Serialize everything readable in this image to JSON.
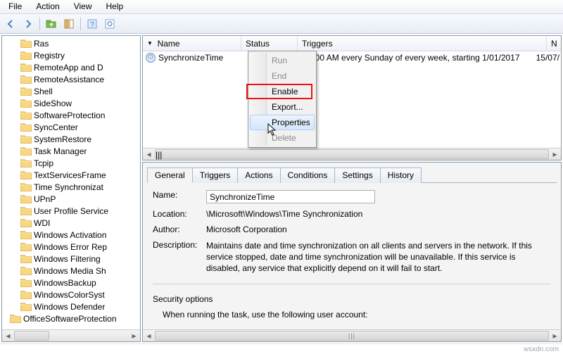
{
  "menubar": {
    "items": [
      "File",
      "Action",
      "View",
      "Help"
    ]
  },
  "tree": {
    "items": [
      {
        "l": 1,
        "t": "Ras"
      },
      {
        "l": 1,
        "t": "Registry"
      },
      {
        "l": 1,
        "t": "RemoteApp and D"
      },
      {
        "l": 1,
        "t": "RemoteAssistance"
      },
      {
        "l": 1,
        "t": "Shell"
      },
      {
        "l": 1,
        "t": "SideShow"
      },
      {
        "l": 1,
        "t": "SoftwareProtection"
      },
      {
        "l": 1,
        "t": "SyncCenter"
      },
      {
        "l": 1,
        "t": "SystemRestore"
      },
      {
        "l": 1,
        "t": "Task Manager"
      },
      {
        "l": 1,
        "t": "Tcpip"
      },
      {
        "l": 1,
        "t": "TextServicesFrame"
      },
      {
        "l": 1,
        "t": "Time Synchronizat"
      },
      {
        "l": 1,
        "t": "UPnP"
      },
      {
        "l": 1,
        "t": "User Profile Service"
      },
      {
        "l": 1,
        "t": "WDI"
      },
      {
        "l": 1,
        "t": "Windows Activation"
      },
      {
        "l": 1,
        "t": "Windows Error Rep"
      },
      {
        "l": 1,
        "t": "Windows Filtering"
      },
      {
        "l": 1,
        "t": "Windows Media Sh"
      },
      {
        "l": 1,
        "t": "WindowsBackup"
      },
      {
        "l": 1,
        "t": "WindowsColorSyst"
      },
      {
        "l": 1,
        "t": "Windows Defender"
      },
      {
        "l": 0,
        "t": "OfficeSoftwareProtection"
      }
    ]
  },
  "columns": {
    "name": "Name",
    "status": "Status",
    "triggers": "Triggers",
    "n": "N"
  },
  "col_sort_glyph": "▼",
  "task_row": {
    "state_glyph": "⊙",
    "name": "SynchronizeTime",
    "trigger_text": "At 1:00 AM every Sunday of every week, starting 1/01/2017",
    "next_run": "15/07/"
  },
  "context_menu": {
    "items": [
      {
        "k": "run",
        "label": "Run",
        "disabled": true
      },
      {
        "k": "end",
        "label": "End",
        "disabled": true
      },
      {
        "k": "enable",
        "label": "Enable",
        "disabled": false,
        "mark": true
      },
      {
        "k": "export",
        "label": "Export...",
        "disabled": false
      },
      {
        "k": "properties",
        "label": "Properties",
        "disabled": false,
        "hover": true
      },
      {
        "k": "delete",
        "label": "Delete",
        "disabled": true
      }
    ]
  },
  "tabs": {
    "items": [
      "General",
      "Triggers",
      "Actions",
      "Conditions",
      "Settings",
      "History"
    ],
    "active": "General"
  },
  "general": {
    "labels": {
      "name": "Name:",
      "location": "Location:",
      "author": "Author:",
      "description": "Description:",
      "security_options": "Security options",
      "running_user": "When running the task, use the following user account:"
    },
    "values": {
      "name": "SynchronizeTime",
      "location": "\\Microsoft\\Windows\\Time Synchronization",
      "author": "Microsoft Corporation",
      "description": "Maintains date and time synchronization on all clients and servers in the network. If this service stopped, date and time synchronization will be unavailable. If this service is disabled, any service that explicitly depend on it will fail to start."
    }
  },
  "scroll_grip": "|||",
  "watermark": "wsxdn.com"
}
